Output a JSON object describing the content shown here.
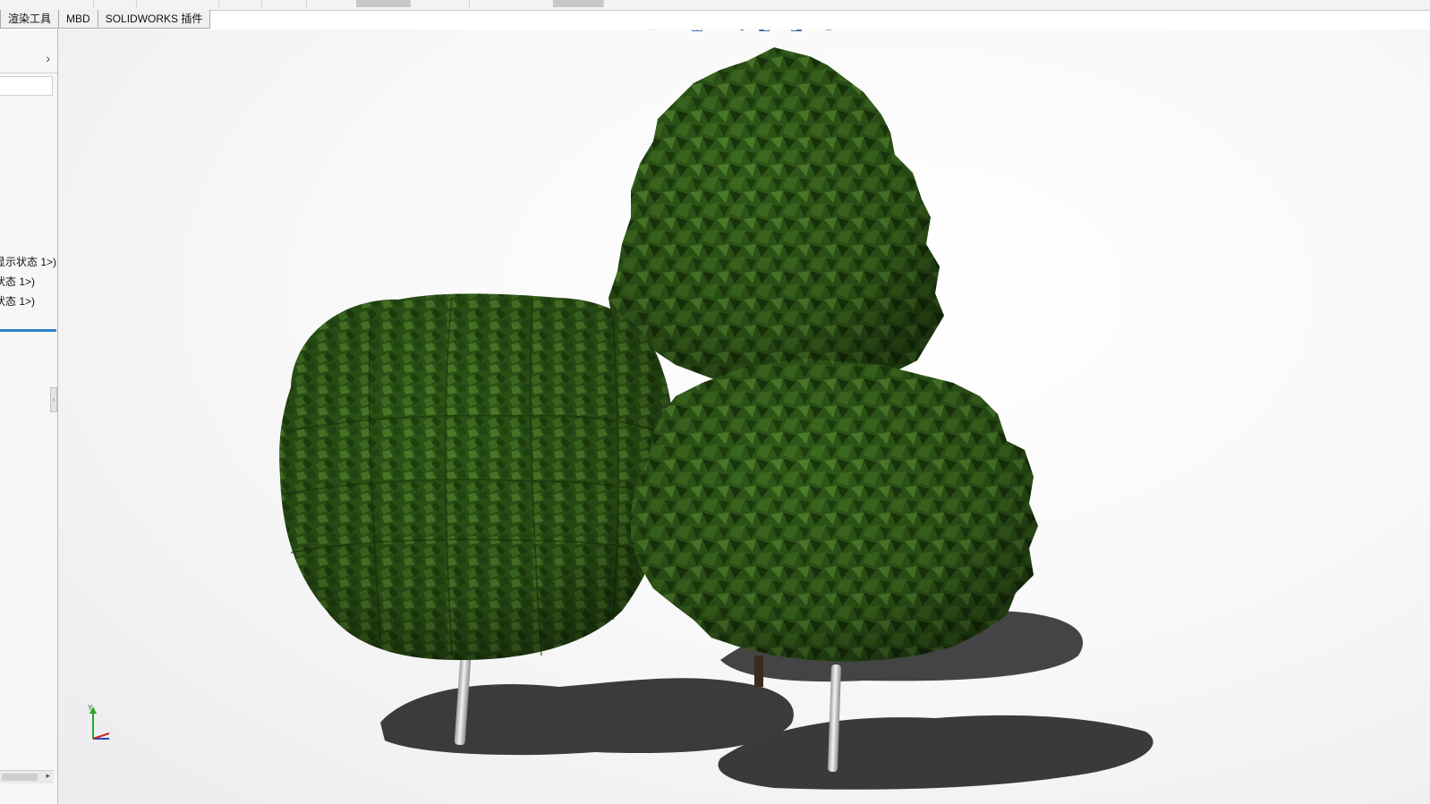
{
  "command_manager": {
    "tabs": [
      "渲染工具",
      "MBD",
      "SOLIDWORKS 插件"
    ]
  },
  "feature_manager": {
    "expand_arrow": "›",
    "tree_items": [
      "显示状态 1>)",
      "状态 1>)",
      "状态 1>)"
    ]
  },
  "heads_up_toolbar": {
    "icons": [
      "view-orientation-icon",
      "zoom-to-fit-icon",
      "zoom-to-area-icon",
      "previous-view-icon",
      "section-view-icon",
      "dynamic-annotation-icon",
      "view-orientation-cube-icon",
      "display-style-icon",
      "hide-show-items-icon",
      "edit-appearance-icon",
      "apply-scene-icon",
      "view-settings-icon"
    ]
  },
  "scene": {
    "description_colors": {
      "foliage_dark": "#1f3d0e",
      "foliage_mid": "#2f5a17",
      "foliage_light": "#4f7d2b",
      "shadow": "#3a3a3a",
      "trunk_silver": "#d8d8d8",
      "background": "#f5f5f6"
    }
  },
  "triad": {
    "y_label": "Y",
    "colors": {
      "x": "#cc2222",
      "y": "#22aa22",
      "z": "#2244cc"
    }
  }
}
